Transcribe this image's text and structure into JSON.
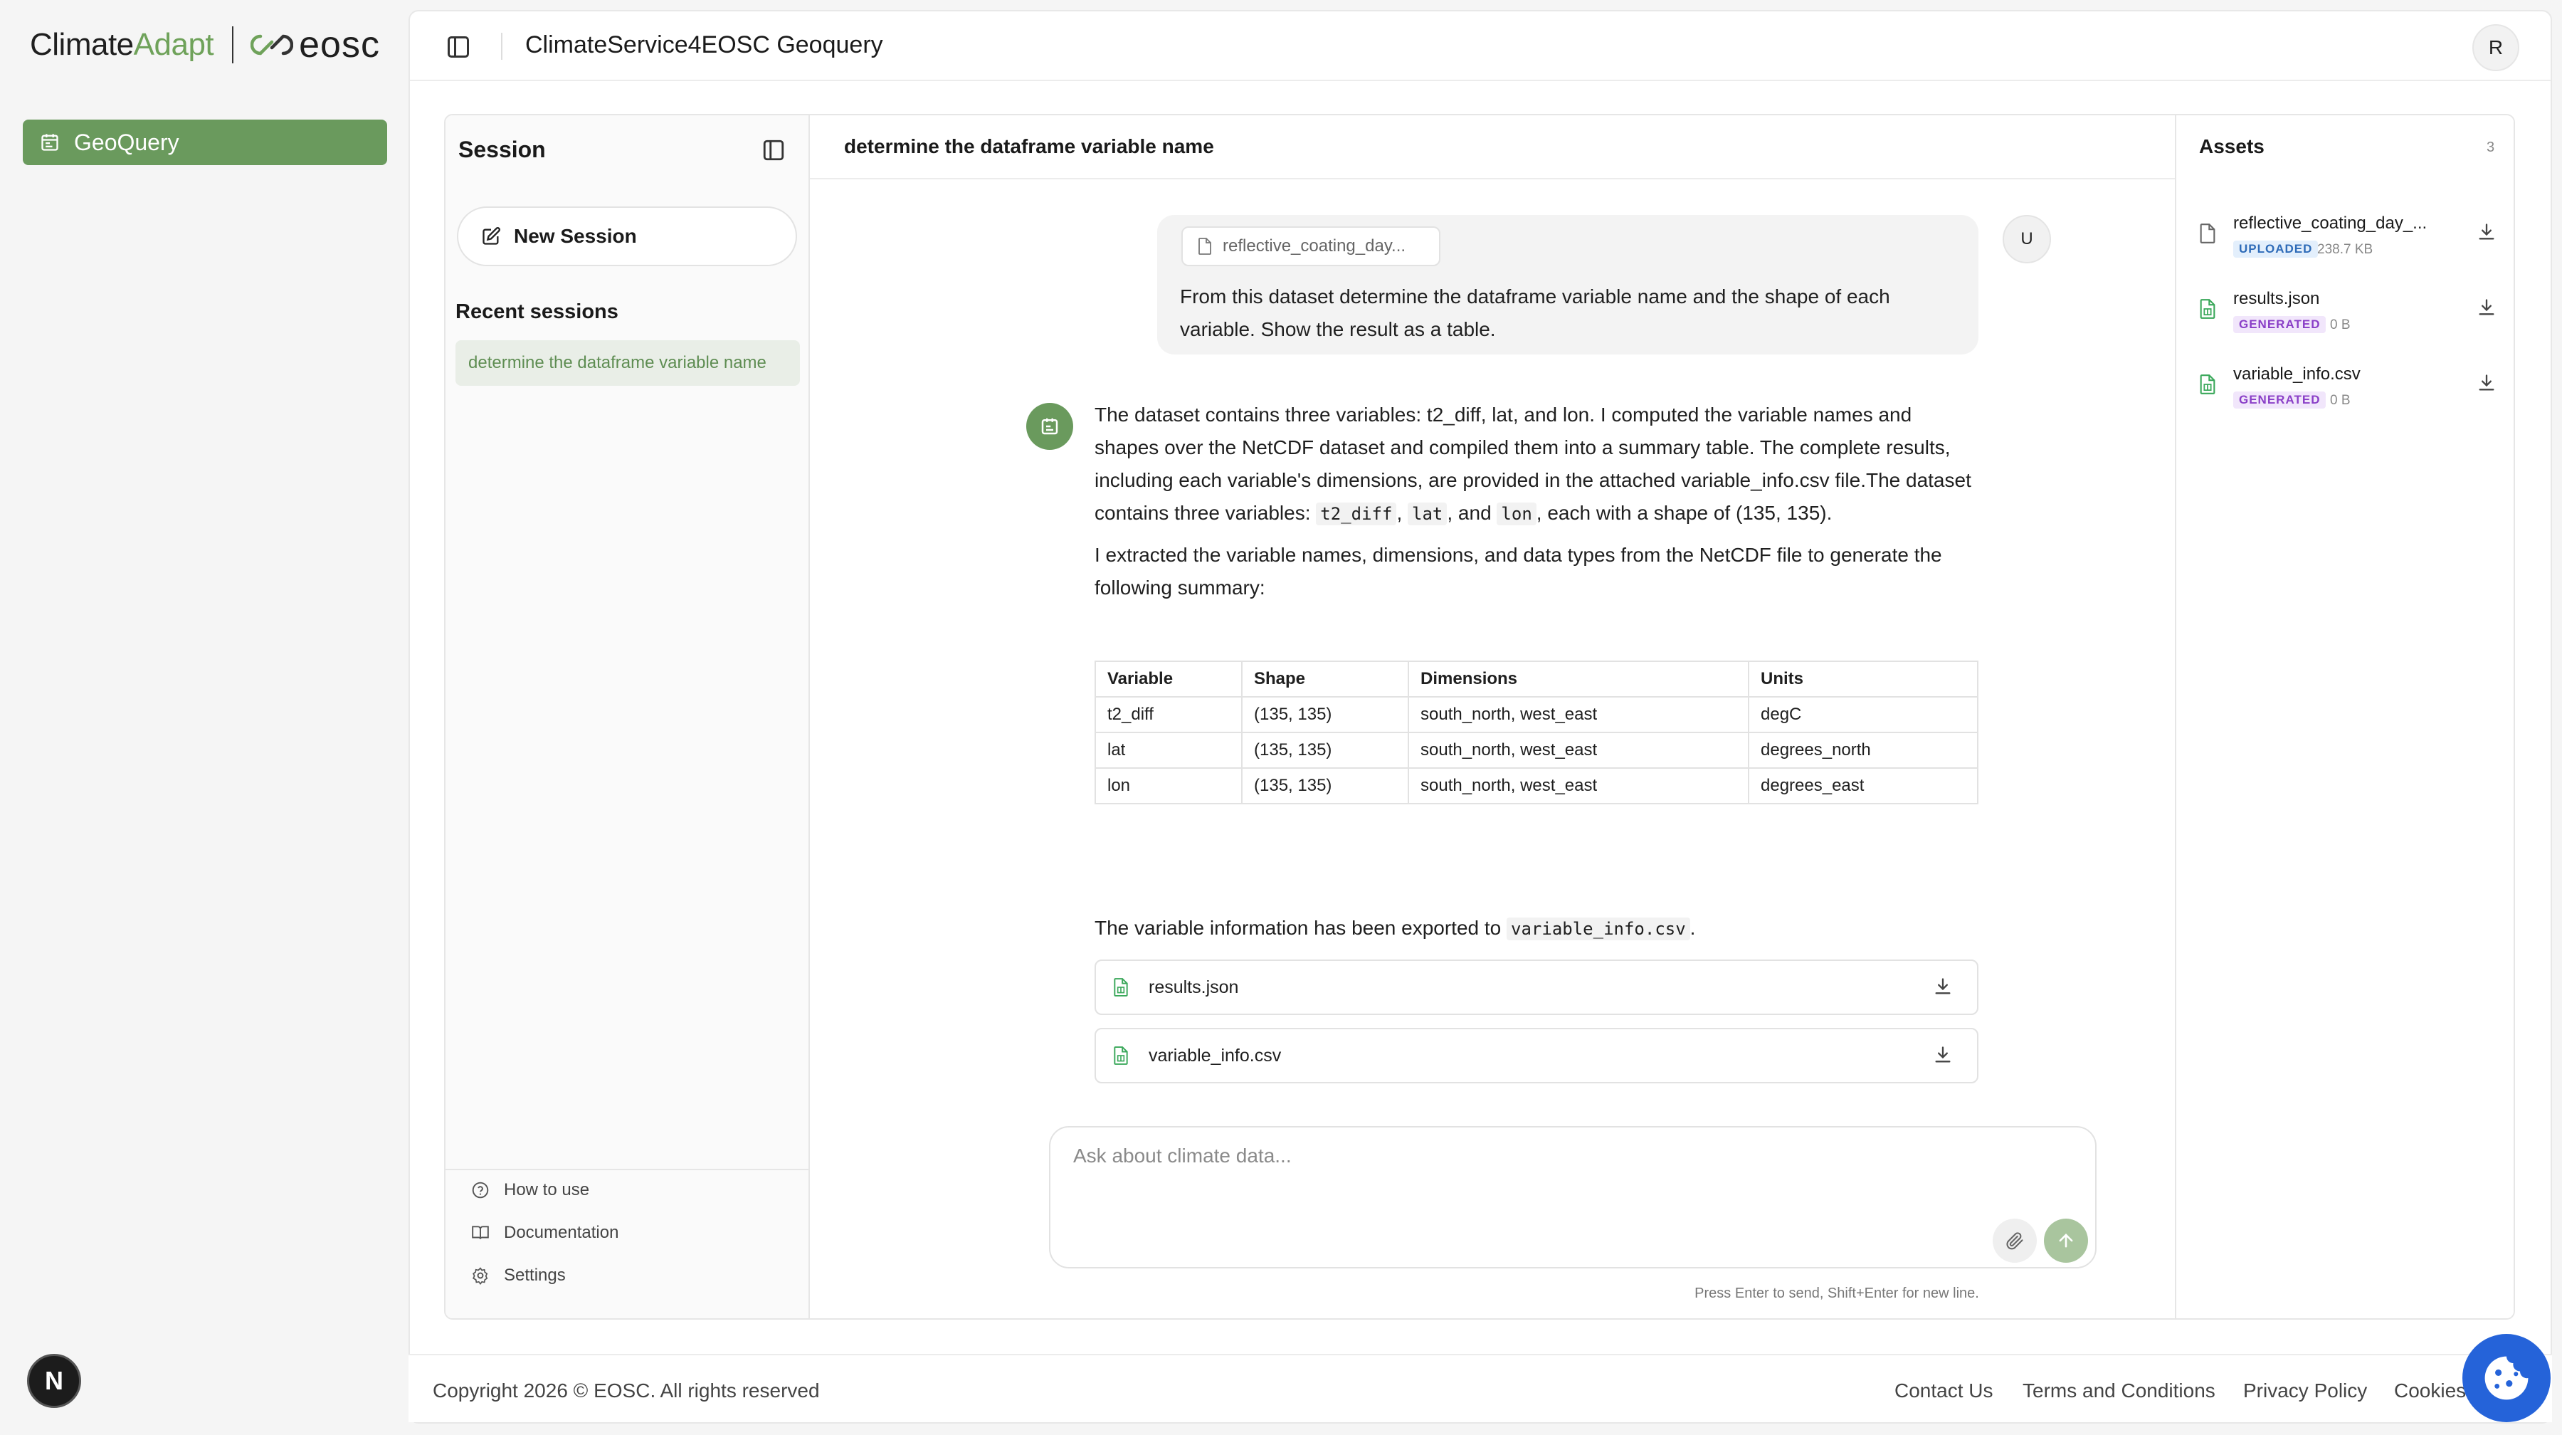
{
  "brand": {
    "climate": "Climate",
    "adapt": "Adapt",
    "eosc": "eosc"
  },
  "sidebar": {
    "items": [
      {
        "label": "GeoQuery",
        "icon": "calendar-icon",
        "active": true
      }
    ]
  },
  "topbar": {
    "title": "ClimateService4EOSC Geoquery",
    "user_initial": "R"
  },
  "session": {
    "title": "Session",
    "new_session_label": "New Session",
    "recent_label": "Recent sessions",
    "recent_items": [
      {
        "label": "determine the dataframe variable name"
      }
    ],
    "footer_links": [
      {
        "label": "How to use",
        "icon": "help-circle-icon"
      },
      {
        "label": "Documentation",
        "icon": "book-icon"
      },
      {
        "label": "Settings",
        "icon": "gear-icon"
      }
    ]
  },
  "chat": {
    "title": "determine the dataframe variable name",
    "user_message": {
      "attachment": "reflective_coating_day...",
      "text": "From this dataset determine the dataframe variable name and the shape of each variable. Show the result as a table.",
      "avatar": "U"
    },
    "assistant": {
      "p1_a": "The dataset contains three variables: t2_diff, lat, and lon. I computed the variable names and shapes over the NetCDF dataset and compiled them into a summary table. The complete results, including each variable's dimensions, are provided in the attached variable_info.csv file.The dataset contains three variables: ",
      "code_t2": "t2_diff",
      "sep1": ", ",
      "code_lat": "lat",
      "sep2": ", and ",
      "code_lon": "lon",
      "p1_b": ", each with a shape of (135, 135).",
      "p2": "I extracted the variable names, dimensions, and data types from the NetCDF file to generate the following summary:",
      "table": {
        "headers": [
          "Variable",
          "Shape",
          "Dimensions",
          "Units"
        ],
        "rows": [
          [
            "t2_diff",
            "(135, 135)",
            "south_north, west_east",
            "degC"
          ],
          [
            "lat",
            "(135, 135)",
            "south_north, west_east",
            "degrees_north"
          ],
          [
            "lon",
            "(135, 135)",
            "south_north, west_east",
            "degrees_east"
          ]
        ]
      },
      "export_prefix": "The variable information has been exported to ",
      "export_file": "variable_info.csv",
      "export_suffix": ".",
      "files": [
        "results.json",
        "variable_info.csv"
      ]
    },
    "composer": {
      "placeholder": "Ask about climate data...",
      "hint": "Press Enter to send, Shift+Enter for new line."
    }
  },
  "assets": {
    "title": "Assets",
    "count": "3",
    "items": [
      {
        "name": "reflective_coating_day_...",
        "badge": "UPLOADED",
        "size": "238.7 KB"
      },
      {
        "name": "results.json",
        "badge": "GENERATED",
        "size": "0 B"
      },
      {
        "name": "variable_info.csv",
        "badge": "GENERATED",
        "size": "0 B"
      }
    ]
  },
  "footer": {
    "copyright": "Copyright 2026 © EOSC. All rights reserved",
    "links": [
      "Contact Us",
      "Terms and Conditions",
      "Privacy Policy",
      "Cookies"
    ]
  },
  "floating": {
    "next_badge": "N"
  },
  "colors": {
    "accent": "#6a9a5d",
    "send_button": "#a9c59e",
    "cookie_button": "#2563d9",
    "uploaded_badge": "#2e6bb8",
    "generated_badge": "#8a3fc7"
  }
}
